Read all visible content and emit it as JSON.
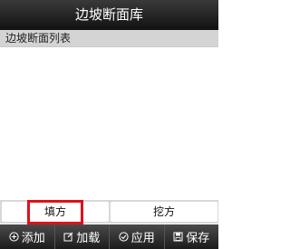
{
  "header": {
    "title": "边坡断面库"
  },
  "list": {
    "header": "边坡断面列表",
    "items": []
  },
  "tabs": [
    {
      "label": "填方",
      "selected": true
    },
    {
      "label": "挖方",
      "selected": false
    }
  ],
  "toolbar": {
    "buttons": [
      {
        "label": "添加",
        "icon": "plus-circle-icon"
      },
      {
        "label": "加载",
        "icon": "load-edit-icon"
      },
      {
        "label": "应用",
        "icon": "check-circle-icon"
      },
      {
        "label": "保存",
        "icon": "save-disk-icon"
      }
    ]
  },
  "colors": {
    "highlight": "#e0101a",
    "titlebar": "#1a1a1a"
  }
}
